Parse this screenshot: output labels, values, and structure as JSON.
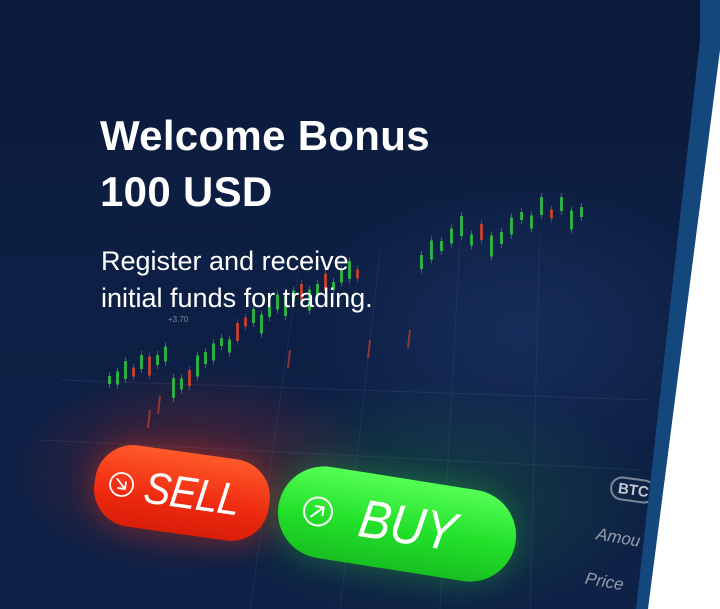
{
  "banner": {
    "headline_line1": "Welcome Bonus",
    "headline_line2": "100 USD",
    "subtext_line1": "Register and receive",
    "subtext_line2": "initial funds for trading."
  },
  "buttons": {
    "sell_label": "SELL",
    "buy_label": "BUY",
    "sell_icon": "arrow-down-right-circle-icon",
    "buy_icon": "arrow-up-right-circle-icon"
  },
  "background_panel": {
    "ticker_badge": "BTC",
    "amount_label": "Amou",
    "price_label": "Price",
    "chart_value_label": "+3.70"
  },
  "colors": {
    "panel_dark": "#0d1f44",
    "edge_blue": "#14477c",
    "sell_red": "#f02a10",
    "buy_green": "#22e02a",
    "candle_green": "#2ecc40",
    "candle_red": "#e0442a"
  }
}
